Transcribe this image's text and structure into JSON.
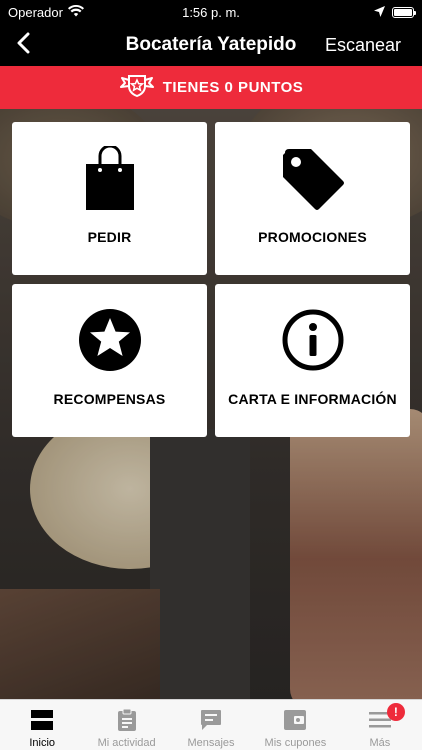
{
  "status_bar": {
    "carrier": "Operador",
    "time": "1:56 p. m.",
    "battery_level": 1.0
  },
  "nav": {
    "title": "Bocatería Yatepido",
    "action_label": "Escanear"
  },
  "points_banner": {
    "text": "TIENES 0 PUNTOS"
  },
  "tiles": [
    {
      "label": "PEDIR",
      "icon": "shopping-bag-icon"
    },
    {
      "label": "PROMOCIONES",
      "icon": "tag-icon"
    },
    {
      "label": "RECOMPENSAS",
      "icon": "star-circle-icon"
    },
    {
      "label": "CARTA E INFORMACIÓN",
      "icon": "info-circle-icon"
    }
  ],
  "tab_bar": {
    "tabs": [
      {
        "label": "Inicio",
        "icon": "home-tiles-icon",
        "active": true
      },
      {
        "label": "Mi actividad",
        "icon": "clipboard-icon",
        "active": false
      },
      {
        "label": "Mensajes",
        "icon": "message-icon",
        "active": false
      },
      {
        "label": "Mis cupones",
        "icon": "wallet-icon",
        "active": false
      },
      {
        "label": "Más",
        "icon": "menu-icon",
        "active": false
      }
    ],
    "more_badge": "!"
  },
  "colors": {
    "accent": "#ee2b3b",
    "nav_background": "#000000",
    "tile_background": "#ffffff"
  }
}
